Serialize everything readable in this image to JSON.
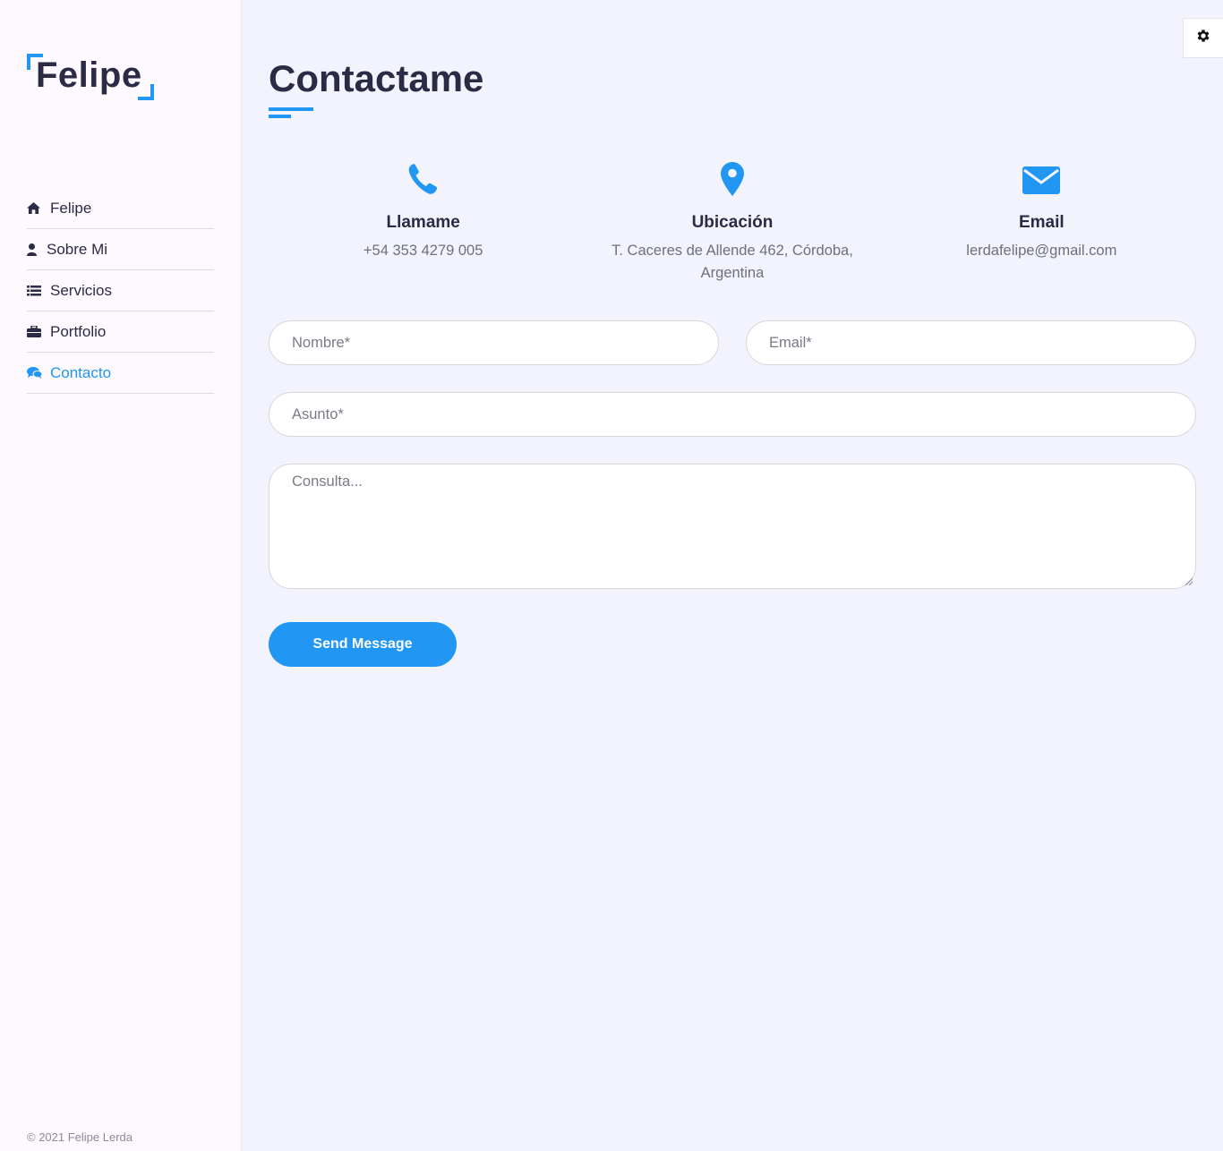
{
  "brand": {
    "logo_text": "Felipe",
    "accent_color": "#2196f3"
  },
  "sidebar": {
    "items": [
      {
        "label": "Felipe",
        "icon": "home-icon",
        "active": false
      },
      {
        "label": "Sobre Mi",
        "icon": "user-icon",
        "active": false
      },
      {
        "label": "Servicios",
        "icon": "list-icon",
        "active": false
      },
      {
        "label": "Portfolio",
        "icon": "briefcase-icon",
        "active": false
      },
      {
        "label": "Contacto",
        "icon": "comments-icon",
        "active": true
      }
    ],
    "copyright": "© 2021 Felipe Lerda"
  },
  "settings": {
    "icon": "gear-icon"
  },
  "page": {
    "title": "Contactame"
  },
  "contact_info": [
    {
      "icon": "phone-icon",
      "title": "Llamame",
      "value": "+54 353 4279 005"
    },
    {
      "icon": "map-pin-icon",
      "title": "Ubicación",
      "value": "T. Caceres de Allende 462, Córdoba, Argentina"
    },
    {
      "icon": "envelope-icon",
      "title": "Email",
      "value": "lerdafelipe@gmail.com"
    }
  ],
  "form": {
    "name_placeholder": "Nombre*",
    "email_placeholder": "Email*",
    "subject_placeholder": "Asunto*",
    "message_placeholder": "Consulta...",
    "submit_label": "Send Message"
  }
}
